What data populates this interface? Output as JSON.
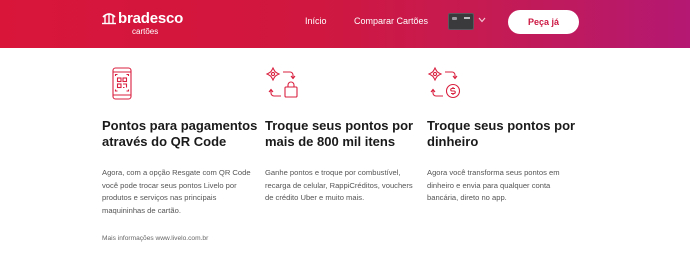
{
  "header": {
    "logo_name": "bradesco",
    "logo_sub": "cartões",
    "nav": {
      "home": "Início",
      "compare": "Comparar Cartões"
    },
    "cta": "Peça já",
    "card_icon": "credit-card-thumbnail",
    "dropdown_icon": "chevron-down-icon"
  },
  "features": [
    {
      "icon": "qr-phone-icon",
      "title": "Pontos para pagamentos através do QR Code",
      "description": "Agora, com a opção Resgate com QR Code você pode trocar seus pontos Livelo por produtos e serviços nas principais maquininhas de cartão."
    },
    {
      "icon": "exchange-gift-icon",
      "title": "Troque seus pontos por mais de 800 mil itens",
      "description": "Ganhe pontos e troque por combustível, recarga de celular, RappiCréditos, vouchers de crédito Uber e muito mais."
    },
    {
      "icon": "exchange-money-icon",
      "title": "Troque seus pontos por dinheiro",
      "description": "Agora você transforma seus pontos em dinheiro e envia para qualquer conta bancária, direto no app."
    }
  ],
  "more_info": "Mais informações www.livelo.com.br",
  "colors": {
    "brand_red": "#cc1742",
    "gradient_end": "#b41872",
    "icon_stroke": "#d9203f"
  }
}
